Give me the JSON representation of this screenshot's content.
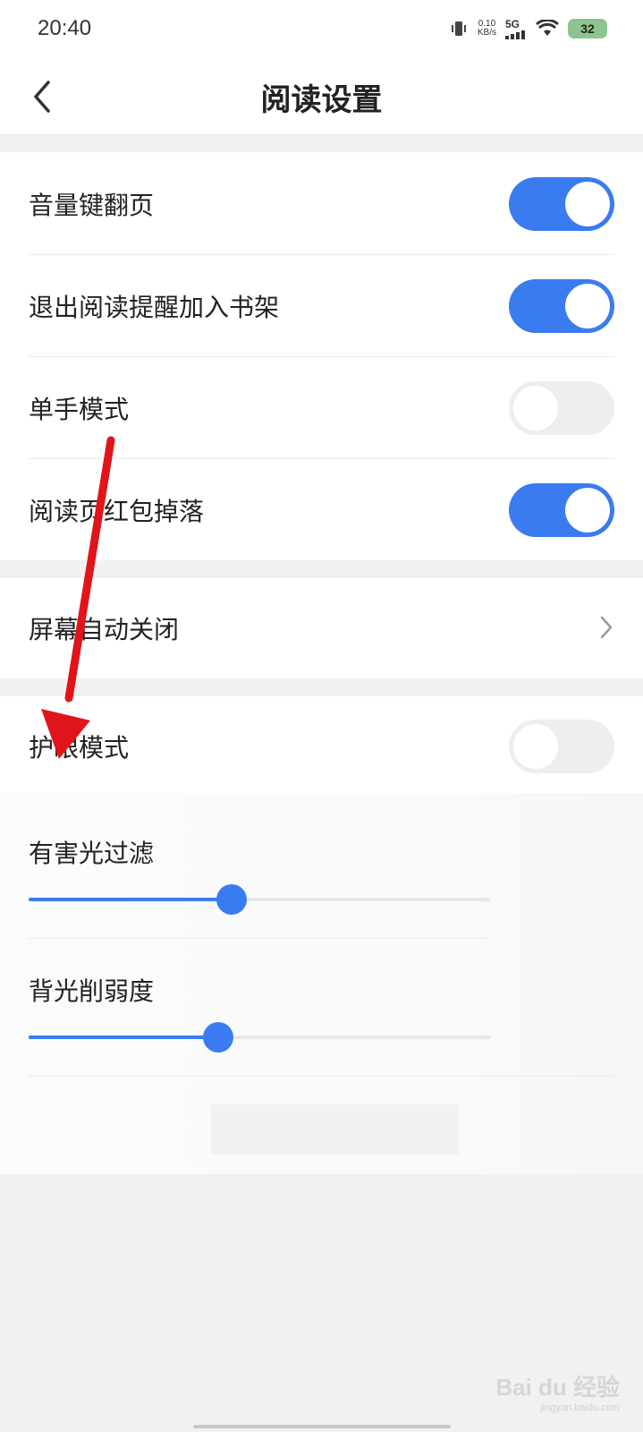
{
  "status_bar": {
    "time": "20:40",
    "net_speed_value": "0.10",
    "net_speed_unit": "KB/s",
    "network": "5G",
    "battery": "32",
    "icons": [
      "vibrate-icon",
      "signal-icon",
      "wifi-icon",
      "battery-icon"
    ]
  },
  "header": {
    "title": "阅读设置",
    "back_icon": "chevron-left-icon"
  },
  "settings": {
    "volume_key_page": {
      "label": "音量键翻页",
      "enabled": true
    },
    "exit_remind_bookshelf": {
      "label": "退出阅读提醒加入书架",
      "enabled": true
    },
    "one_hand_mode": {
      "label": "单手模式",
      "enabled": false
    },
    "red_packet_drop": {
      "label": "阅读页红包掉落",
      "enabled": true
    },
    "screen_auto_off": {
      "label": "屏幕自动关闭",
      "icon": "chevron-right-icon"
    },
    "eye_protection": {
      "label": "护眼模式",
      "enabled": false
    },
    "harmful_light_filter": {
      "label": "有害光过滤",
      "level": 0.44
    },
    "backlight_reduction": {
      "label": "背光削弱度",
      "level": 0.41
    }
  },
  "colors": {
    "accent": "#3b7bf0",
    "annotation_arrow": "#e0141b",
    "switch_off": "#eeeeee"
  },
  "watermark": {
    "main": "Bai du 经验",
    "sub": "jingyan.baidu.com"
  }
}
